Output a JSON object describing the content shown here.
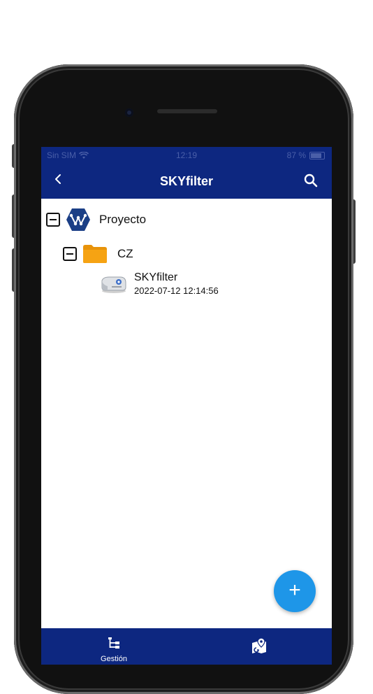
{
  "status_bar": {
    "carrier": "Sin SIM",
    "time": "12:19",
    "battery": "87 %"
  },
  "nav": {
    "title": "SKYfilter",
    "back_icon": "chevron-left-icon",
    "search_icon": "search-icon"
  },
  "tree": {
    "project": {
      "label": "Proyecto"
    },
    "folder": {
      "label": "CZ"
    },
    "device": {
      "name": "SKYfilter",
      "timestamp": "2022-07-12 12:14:56"
    }
  },
  "fab": {
    "label": "+"
  },
  "tabs": [
    {
      "label": "Gestión",
      "icon": "tree-hierarchy-icon"
    },
    {
      "label": "",
      "icon": "map-pin-icon"
    }
  ],
  "colors": {
    "primary": "#0d2780",
    "fab": "#1e96e8",
    "folder": "#f6a313"
  }
}
